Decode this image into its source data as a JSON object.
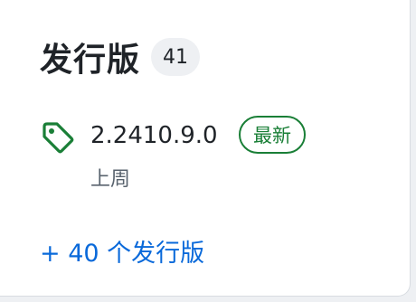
{
  "releases": {
    "title": "发行版",
    "count": "41",
    "latest": {
      "version": "2.2410.9.0",
      "badge": "最新",
      "date": "上周"
    },
    "more_link": "+ 40 个发行版"
  },
  "colors": {
    "text_primary": "#1f2328",
    "text_muted": "#59636e",
    "latest_green": "#1a7f37",
    "link_blue": "#0969da",
    "counter_bg": "#eef0f3"
  },
  "icons": {
    "release": "tag-icon"
  }
}
